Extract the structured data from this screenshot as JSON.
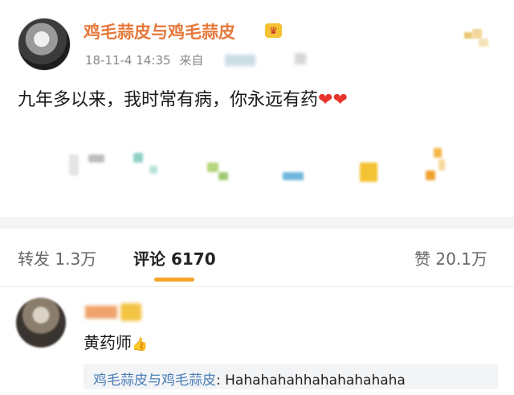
{
  "post": {
    "author": "鸡毛蒜皮与鸡毛蒜皮",
    "badge_icon": "crown-icon",
    "time": "18-11-4 14:35",
    "source_prefix": "来自",
    "text": "九年多以来，我时常有病，你永远有药",
    "emoji": "❤❤"
  },
  "tabs": [
    {
      "label": "转发",
      "count": "1.3万"
    },
    {
      "label": "评论",
      "count": "6170"
    },
    {
      "label": "赞",
      "count": "20.1万"
    }
  ],
  "comment": {
    "text": "黄药师",
    "emoji": "👍",
    "reply_author": "鸡毛蒜皮与鸡毛蒜皮",
    "reply_sep": ":",
    "reply_text": " Hahahahahhahahahahaha"
  },
  "colors": {
    "author": "#e6783a",
    "accent": "#f5a42a",
    "link": "#4a7db8"
  }
}
